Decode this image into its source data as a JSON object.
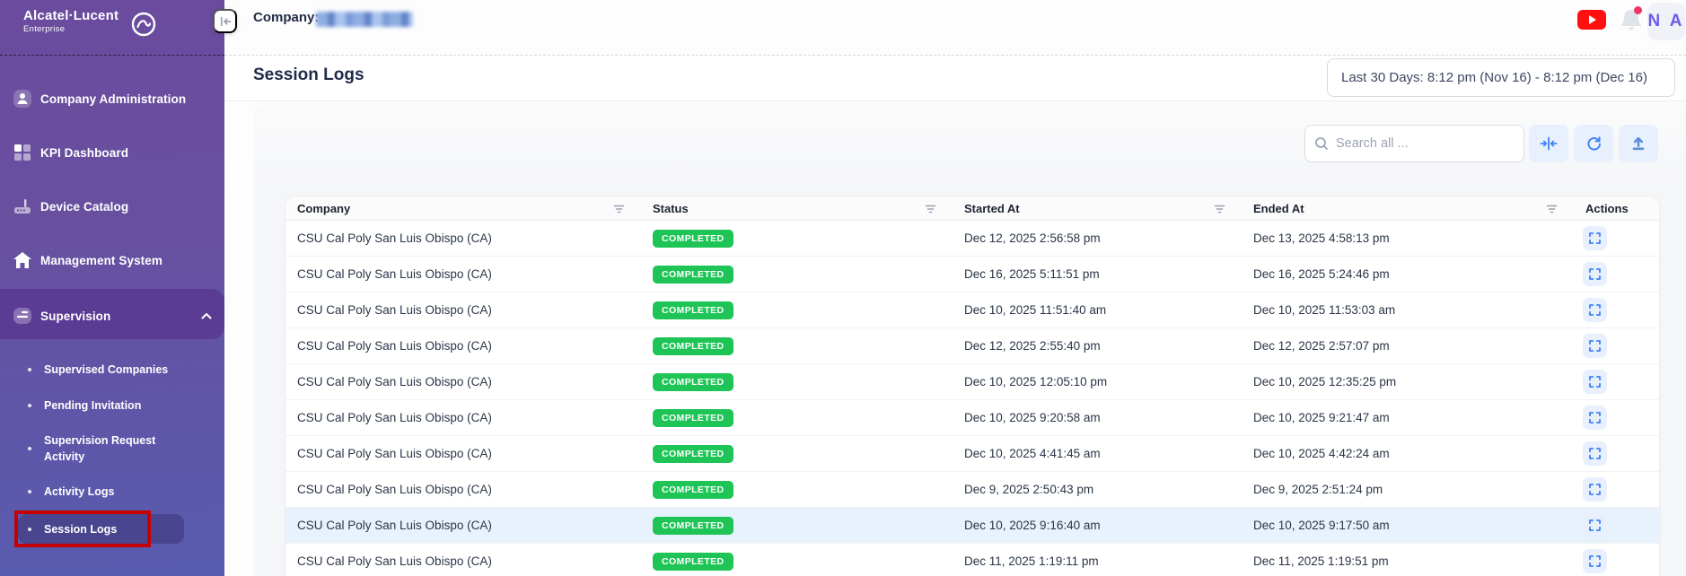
{
  "brand": {
    "name": "Alcatel·Lucent",
    "tagline": "Enterprise"
  },
  "topbar": {
    "company_label": "Company:",
    "avatar_initials": "N A"
  },
  "titlebar": {
    "title": "Session Logs",
    "date_range": "Last 30 Days: 8:12 pm (Nov 16) - 8:12 pm (Dec 16)"
  },
  "toolbar": {
    "search_placeholder": "Search all ..."
  },
  "sidebar": {
    "items": [
      {
        "label": "Company Administration"
      },
      {
        "label": "KPI Dashboard"
      },
      {
        "label": "Device Catalog"
      },
      {
        "label": "Management System"
      },
      {
        "label": "Supervision",
        "expanded": true
      }
    ],
    "supervision_children": [
      {
        "label": "Supervised Companies"
      },
      {
        "label": "Pending Invitation"
      },
      {
        "label": "Supervision Request Activity"
      },
      {
        "label": "Activity Logs"
      },
      {
        "label": "Session Logs",
        "active": true
      }
    ]
  },
  "table": {
    "columns": [
      "Company",
      "Status",
      "Started At",
      "Ended At",
      "Actions"
    ],
    "rows": [
      {
        "company": "CSU Cal Poly San Luis Obispo (CA)",
        "status": "COMPLETED",
        "started": "Dec 12, 2025 2:56:58 pm",
        "ended": "Dec 13, 2025 4:58:13 pm",
        "highlighted": false
      },
      {
        "company": "CSU Cal Poly San Luis Obispo (CA)",
        "status": "COMPLETED",
        "started": "Dec 16, 2025 5:11:51 pm",
        "ended": "Dec 16, 2025 5:24:46 pm",
        "highlighted": false
      },
      {
        "company": "CSU Cal Poly San Luis Obispo (CA)",
        "status": "COMPLETED",
        "started": "Dec 10, 2025 11:51:40 am",
        "ended": "Dec 10, 2025 11:53:03 am",
        "highlighted": false
      },
      {
        "company": "CSU Cal Poly San Luis Obispo (CA)",
        "status": "COMPLETED",
        "started": "Dec 12, 2025 2:55:40 pm",
        "ended": "Dec 12, 2025 2:57:07 pm",
        "highlighted": false
      },
      {
        "company": "CSU Cal Poly San Luis Obispo (CA)",
        "status": "COMPLETED",
        "started": "Dec 10, 2025 12:05:10 pm",
        "ended": "Dec 10, 2025 12:35:25 pm",
        "highlighted": false
      },
      {
        "company": "CSU Cal Poly San Luis Obispo (CA)",
        "status": "COMPLETED",
        "started": "Dec 10, 2025 9:20:58 am",
        "ended": "Dec 10, 2025 9:21:47 am",
        "highlighted": false
      },
      {
        "company": "CSU Cal Poly San Luis Obispo (CA)",
        "status": "COMPLETED",
        "started": "Dec 10, 2025 4:41:45 am",
        "ended": "Dec 10, 2025 4:42:24 am",
        "highlighted": false
      },
      {
        "company": "CSU Cal Poly San Luis Obispo (CA)",
        "status": "COMPLETED",
        "started": "Dec 9, 2025 2:50:43 pm",
        "ended": "Dec 9, 2025 2:51:24 pm",
        "highlighted": false
      },
      {
        "company": "CSU Cal Poly San Luis Obispo (CA)",
        "status": "COMPLETED",
        "started": "Dec 10, 2025 9:16:40 am",
        "ended": "Dec 10, 2025 9:17:50 am",
        "highlighted": true
      },
      {
        "company": "CSU Cal Poly San Luis Obispo (CA)",
        "status": "COMPLETED",
        "started": "Dec 11, 2025 1:19:11 pm",
        "ended": "Dec 11, 2025 1:19:51 pm",
        "highlighted": false
      }
    ]
  },
  "colors": {
    "sidebar_purple": "#6b4b9e",
    "status_green": "#1ec556",
    "accent_blue": "#3b82f6",
    "annotation_red": "#c40000",
    "avatar_text": "#6c5ce7"
  }
}
